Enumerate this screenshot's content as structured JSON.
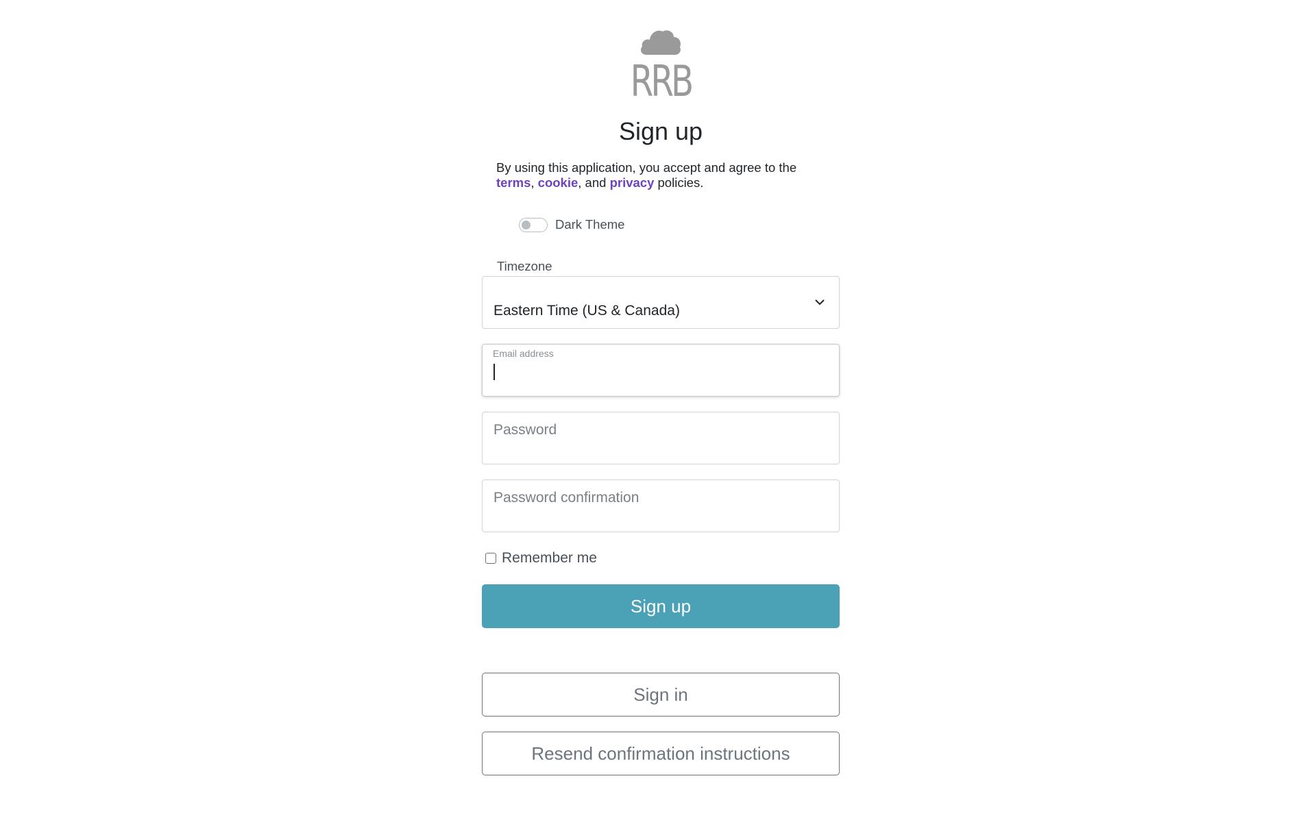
{
  "logo": {
    "text": "RRB",
    "icon": "cloud-icon",
    "color": "#9a9a9a"
  },
  "title": "Sign up",
  "legal": {
    "prefix": "By using this application, you accept and agree to the",
    "link_terms": "terms",
    "sep1": ",",
    "link_cookie": "cookie",
    "sep2": ", and",
    "link_privacy": "privacy",
    "suffix": "policies.",
    "link_color": "#6f42c1"
  },
  "theme_toggle": {
    "label": "Dark Theme",
    "checked": false
  },
  "timezone": {
    "label": "Timezone",
    "selected": "Eastern Time (US & Canada)"
  },
  "email": {
    "label": "Email address",
    "value": "",
    "focused": true
  },
  "password": {
    "placeholder": "Password"
  },
  "password_confirmation": {
    "placeholder": "Password confirmation"
  },
  "remember": {
    "label": "Remember me",
    "checked": false
  },
  "buttons": {
    "sign_up": "Sign up",
    "sign_in": "Sign in",
    "resend": "Resend confirmation instructions"
  },
  "colors": {
    "primary": "#4ba2b7",
    "outline": "#6c757d"
  }
}
